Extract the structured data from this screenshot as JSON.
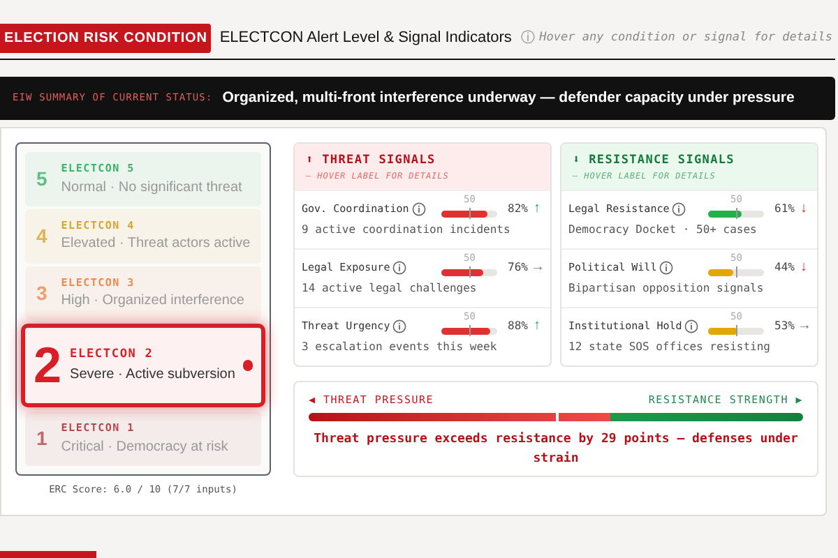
{
  "header": {
    "badge": "ELECTION RISK CONDITION",
    "title": "ELECTCON Alert Level & Signal Indicators",
    "hint_icon": "ⓘ",
    "hint": "Hover any condition or signal for details"
  },
  "summary": {
    "label": "EIW SUMMARY OF CURRENT STATUS:",
    "text": "Organized, multi-front interference underway — defender capacity under pressure"
  },
  "levels": [
    {
      "number": "5",
      "name": "ELECTCON 5",
      "description": "Normal · No significant threat",
      "color": "#3bb36a",
      "selected": false
    },
    {
      "number": "4",
      "name": "ELECTCON 4",
      "description": "Elevated · Threat actors active",
      "color": "#d9a531",
      "selected": false
    },
    {
      "number": "3",
      "name": "ELECTCON 3",
      "description": "High · Organized interference",
      "color": "#ea8a4f",
      "selected": false
    },
    {
      "number": "2",
      "name": "ELECTCON 2",
      "description": "Severe · Active subversion",
      "color": "#d61f26",
      "selected": true
    },
    {
      "number": "1",
      "name": "ELECTCON 1",
      "description": "Critical · Democracy at risk",
      "color": "#b8474d",
      "selected": false
    }
  ],
  "erc_score": "ERC Score: 6.0 / 10 (7/7 inputs)",
  "panels": [
    {
      "kind": "threat",
      "icon": "⬆",
      "title": "THREAT SIGNALS",
      "hint": "— HOVER LABEL FOR DETAILS",
      "signals": [
        {
          "label": "Gov. Coordination",
          "detail": "9 active coordination incidents",
          "level": 0.82,
          "value": "82%",
          "marker": "50",
          "trend": {
            "glyph": "↑",
            "kind": "up"
          },
          "color": "#e03131"
        },
        {
          "label": "Legal Exposure",
          "detail": "14 active legal challenges",
          "level": 0.76,
          "value": "76%",
          "marker": "50",
          "trend": {
            "glyph": "→",
            "kind": "flat"
          },
          "color": "#e03131"
        },
        {
          "label": "Threat Urgency",
          "detail": "3 escalation events this week",
          "level": 0.88,
          "value": "88%",
          "marker": "50",
          "trend": {
            "glyph": "↑",
            "kind": "up"
          },
          "color": "#e03131"
        }
      ]
    },
    {
      "kind": "resistance",
      "icon": "⬇",
      "title": "RESISTANCE SIGNALS",
      "hint": "— HOVER LABEL FOR DETAILS",
      "signals": [
        {
          "label": "Legal Resistance",
          "detail": "Democracy Docket · 50+ cases",
          "level": 0.61,
          "value": "61%",
          "marker": "50",
          "trend": {
            "glyph": "↓",
            "kind": "down"
          },
          "color": "#22b04a"
        },
        {
          "label": "Political Will",
          "detail": "Bipartisan opposition signals",
          "level": 0.44,
          "value": "44%",
          "marker": "50",
          "trend": {
            "glyph": "↓",
            "kind": "down"
          },
          "color": "#e0a800"
        },
        {
          "label": "Institutional Hold",
          "detail": "12 state SOS offices resisting",
          "level": 0.53,
          "value": "53%",
          "marker": "50",
          "trend": {
            "glyph": "→",
            "kind": "flat"
          },
          "color": "#e0a800"
        }
      ]
    }
  ],
  "balance": {
    "left_icon": "◀",
    "left_label": "THREAT PRESSURE",
    "right_label": "RESISTANCE STRENGTH",
    "right_icon": "▶",
    "level": 0.61,
    "verdict": "Threat pressure exceeds resistance by 29 points — defenses under strain"
  }
}
